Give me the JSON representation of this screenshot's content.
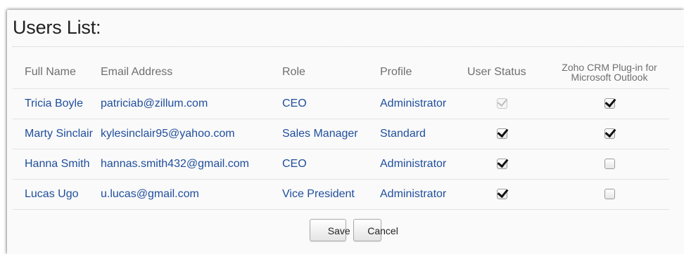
{
  "page": {
    "title": "Users List:"
  },
  "table": {
    "headers": {
      "full_name": "Full Name",
      "email": "Email Address",
      "role": "Role",
      "profile": "Profile",
      "user_status": "User Status",
      "plugin_line1": "Zoho CRM Plug-in for",
      "plugin_line2": "Microsoft Outlook"
    },
    "rows": [
      {
        "full_name": "Tricia Boyle",
        "email": "patriciab@zillum.com",
        "role": "CEO",
        "profile": "Administrator",
        "user_status": true,
        "user_status_disabled": true,
        "plugin": true
      },
      {
        "full_name": "Marty Sinclair",
        "email": "kylesinclair95@yahoo.com",
        "role": "Sales Manager",
        "profile": "Standard",
        "user_status": true,
        "user_status_disabled": false,
        "plugin": true
      },
      {
        "full_name": "Hanna Smith",
        "email": "hannas.smith432@gmail.com",
        "role": "CEO",
        "profile": "Administrator",
        "user_status": true,
        "user_status_disabled": false,
        "plugin": false
      },
      {
        "full_name": "Lucas Ugo",
        "email": "u.lucas@gmail.com",
        "role": "Vice President",
        "profile": "Administrator",
        "user_status": true,
        "user_status_disabled": false,
        "plugin": false
      }
    ]
  },
  "buttons": {
    "save": "Save",
    "cancel": "Cancel"
  },
  "colors": {
    "link_text": "#1f4e9c",
    "header_text": "#6f6f6f",
    "title_text": "#222222"
  }
}
